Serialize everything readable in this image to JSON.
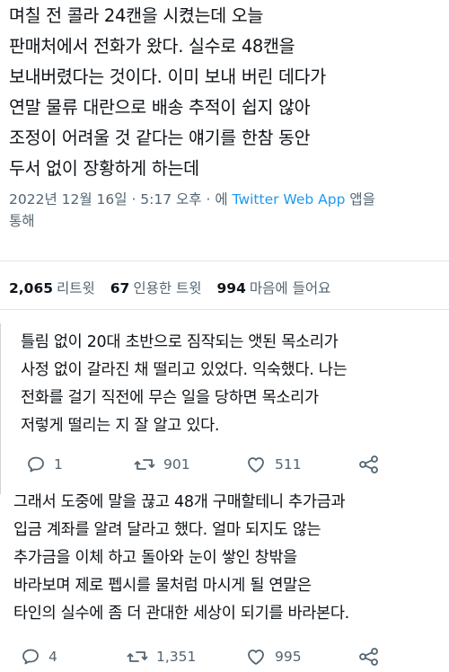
{
  "tweet1": {
    "lines": [
      "며칠 전 콜라 24캔을 시켰는데 오늘",
      "판매처에서 전화가 왔다. 실수로 48캔을",
      "보내버렸다는 것이다. 이미 보내 버린 데다가",
      "연말 물류 대란으로 배송 추적이 쉽지 않아",
      "조정이 어려울 것 같다는 얘기를 한참 동안",
      "두서 없이 장황하게 하는데"
    ],
    "timestamp": "2022년 12월 16일 · 5:17 오후 · 에",
    "source": "Twitter Web App",
    "source_suffix": "앱을",
    "timestamp_line2": "통해"
  },
  "stats": {
    "retweets_count": "2,065",
    "retweets_label": "리트윗",
    "quotes_count": "67",
    "quotes_label": "인용한 트윗",
    "likes_count": "994",
    "likes_label": "마음에 들어요"
  },
  "tweet2": {
    "lines": [
      "틀림 없이 20대 초반으로 짐작되는 앳된 목소리가",
      "사정 없이 갈라진 채 떨리고 있었다. 익숙했다. 나는",
      "전화를 걸기 직전에 무슨 일을 당하면 목소리가",
      "저렇게 떨리는 지 잘 알고 있다."
    ],
    "replies": "1",
    "retweets": "901",
    "likes": "511"
  },
  "tweet3": {
    "lines": [
      "그래서 도중에 말을 끊고 48개 구매할테니 추가금과",
      "입금 계좌를 알려 달라고 했다. 얼마 되지도 않는",
      "추가금을 이체 하고 돌아와 눈이 쌓인 창밖을",
      "바라보며 제로 펩시를 물처럼 마시게 될 연말은",
      "타인의 실수에 좀 더 관대한 세상이 되기를 바라본다."
    ],
    "replies": "4",
    "retweets": "1,351",
    "likes": "995"
  },
  "icons": {
    "reply": "reply-icon",
    "retweet": "retweet-icon",
    "like": "heart-icon",
    "share": "share-icon"
  },
  "colors": {
    "text": "#0f1419",
    "muted": "#536471",
    "link": "#1d9bf0"
  }
}
